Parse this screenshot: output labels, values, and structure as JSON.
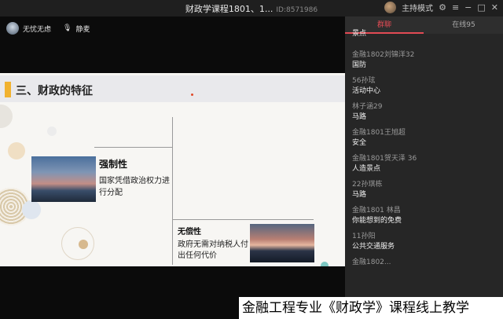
{
  "window": {
    "title": "财政学课程1801、1...",
    "room_id": "ID:8571986",
    "mode_label": "主持模式"
  },
  "presenter": {
    "name": "无忧无虑",
    "mic_label": "静麦"
  },
  "slide": {
    "heading": "三、财政的特征",
    "item1_title": "强制性",
    "item1_desc": "国家凭借政治权力进行分配",
    "item2_title": "无偿性",
    "item2_desc": "政府无需对纳税人付出任何代价"
  },
  "chat": {
    "tab_active": "群聊",
    "tab_online": "在线95",
    "messages": [
      {
        "name": "",
        "text": "景点"
      },
      {
        "name": "金融1802刘锦洋32",
        "text": "国防"
      },
      {
        "name": "56孙玹",
        "text": "活动中心"
      },
      {
        "name": "林子涵29",
        "text": "马路"
      },
      {
        "name": "金融1801王旭超",
        "text": "安全"
      },
      {
        "name": "金融1801贺天泽 36",
        "text": "人造景点"
      },
      {
        "name": "22孙琪栋",
        "text": "马路"
      },
      {
        "name": "金融1801 林昌",
        "text": "你能想到的免费"
      },
      {
        "name": "11孙阳",
        "text": "公共交通服务"
      },
      {
        "name": "金融1802...",
        "text": ""
      }
    ]
  },
  "caption": "金融工程专业《财政学》课程线上教学",
  "colors": {
    "accent": "#e14b54",
    "slide_bar": "#f1b230"
  }
}
